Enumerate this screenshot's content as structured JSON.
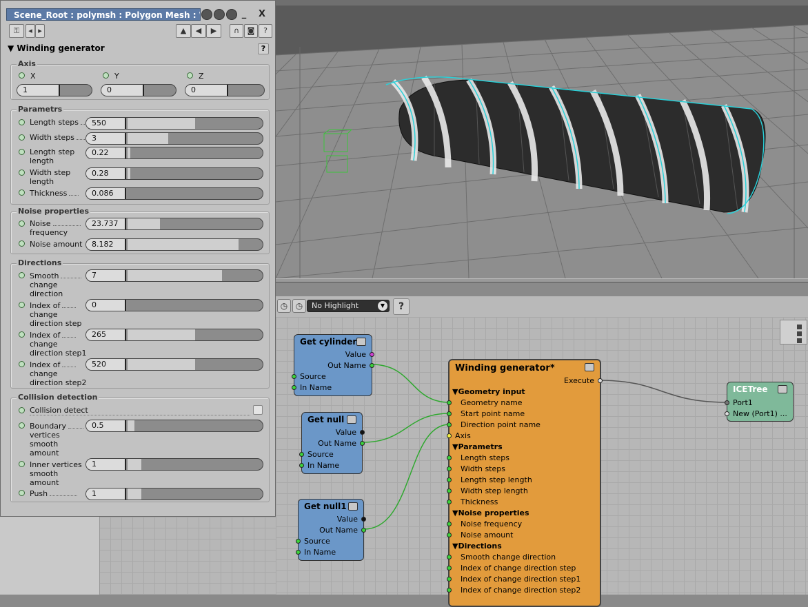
{
  "window": {
    "title": "Scene_Root : polymsh : Polygon Mesh : Windin...",
    "close_label": "X",
    "min_label": "_"
  },
  "ppg": {
    "section_title": "Winding generator",
    "help": "?",
    "axis_group": "Axis",
    "axis": [
      {
        "label": "X",
        "value": "1",
        "fraction": 0.5
      },
      {
        "label": "Y",
        "value": "0",
        "fraction": 0.5
      },
      {
        "label": "Z",
        "value": "0",
        "fraction": 0.5
      }
    ],
    "parametrs_group": "Parametrs",
    "parametrs": [
      {
        "label1": "Length steps",
        "label2": "",
        "value": "550",
        "fraction": 0.5
      },
      {
        "label1": "Width steps",
        "label2": "",
        "value": "3",
        "fraction": 0.3
      },
      {
        "label1": "Length step",
        "label2": "length",
        "value": "0.22",
        "fraction": 0.02
      },
      {
        "label1": "Width step",
        "label2": "length",
        "value": "0.28",
        "fraction": 0.02
      },
      {
        "label1": "Thickness",
        "label2": "",
        "value": "0.086",
        "fraction": 0.0
      }
    ],
    "noise_group": "Noise properties",
    "noise": [
      {
        "label1": "Noise",
        "label2": "frequency",
        "value": "23.737",
        "fraction": 0.24
      },
      {
        "label1": "Noise amount",
        "label2": "",
        "value": "8.182",
        "fraction": 0.82
      }
    ],
    "directions_group": "Directions",
    "directions": [
      {
        "label1": "Smooth",
        "label2": "change",
        "label3": "direction",
        "value": "7",
        "fraction": 0.7
      },
      {
        "label1": "Index of",
        "label2": "change",
        "label3": "direction step",
        "value": "0",
        "fraction": 0.0
      },
      {
        "label1": "Index of",
        "label2": "change",
        "label3": "direction step1",
        "value": "265",
        "fraction": 0.5
      },
      {
        "label1": "Index of",
        "label2": "change",
        "label3": "direction step2",
        "value": "520",
        "fraction": 0.5
      }
    ],
    "collision_group": "Collision detection",
    "collision_detect_label": "Collision detect",
    "collision": [
      {
        "label1": "Boundary",
        "label2": "vertices",
        "label3": "smooth",
        "label4": "amount",
        "value": "0.5",
        "fraction": 0.05
      },
      {
        "label1": "Inner vertices",
        "label2": "smooth",
        "label3": "amount",
        "label4": "",
        "value": "1",
        "fraction": 0.1
      },
      {
        "label1": "Push",
        "label2": "",
        "label3": "",
        "label4": "",
        "value": "1",
        "fraction": 0.1
      }
    ]
  },
  "ice_toolbar": {
    "highlight": "No Highlight",
    "help": "?"
  },
  "nodes": {
    "get_cylinder": {
      "title": "Get cylinder",
      "ports": [
        "Value",
        "Out Name",
        "Source",
        "In Name"
      ]
    },
    "get_null": {
      "title": "Get null",
      "ports": [
        "Value",
        "Out Name",
        "Source",
        "In Name"
      ]
    },
    "get_null1": {
      "title": "Get null1",
      "ports": [
        "Value",
        "Out Name",
        "Source",
        "In Name"
      ]
    },
    "winding": {
      "title": "Winding generator*",
      "execute": "Execute",
      "sec_geometry": "Geometry input",
      "geometry": [
        "Geometry name",
        "Start point name",
        "Direction point name",
        "Axis"
      ],
      "sec_parametrs": "Parametrs",
      "parametrs": [
        "Length steps",
        "Width steps",
        "Length step length",
        "Width step length",
        "Thickness"
      ],
      "sec_noise": "Noise properties",
      "noise": [
        "Noise frequency",
        "Noise amount"
      ],
      "sec_directions": "Directions",
      "directions": [
        "Smooth change direction",
        "Index of change direction step",
        "Index of change direction step1",
        "Index of change direction step2"
      ]
    },
    "icetree": {
      "title": "ICETree",
      "ports": [
        "Port1",
        "New (Port1) ..."
      ]
    }
  }
}
